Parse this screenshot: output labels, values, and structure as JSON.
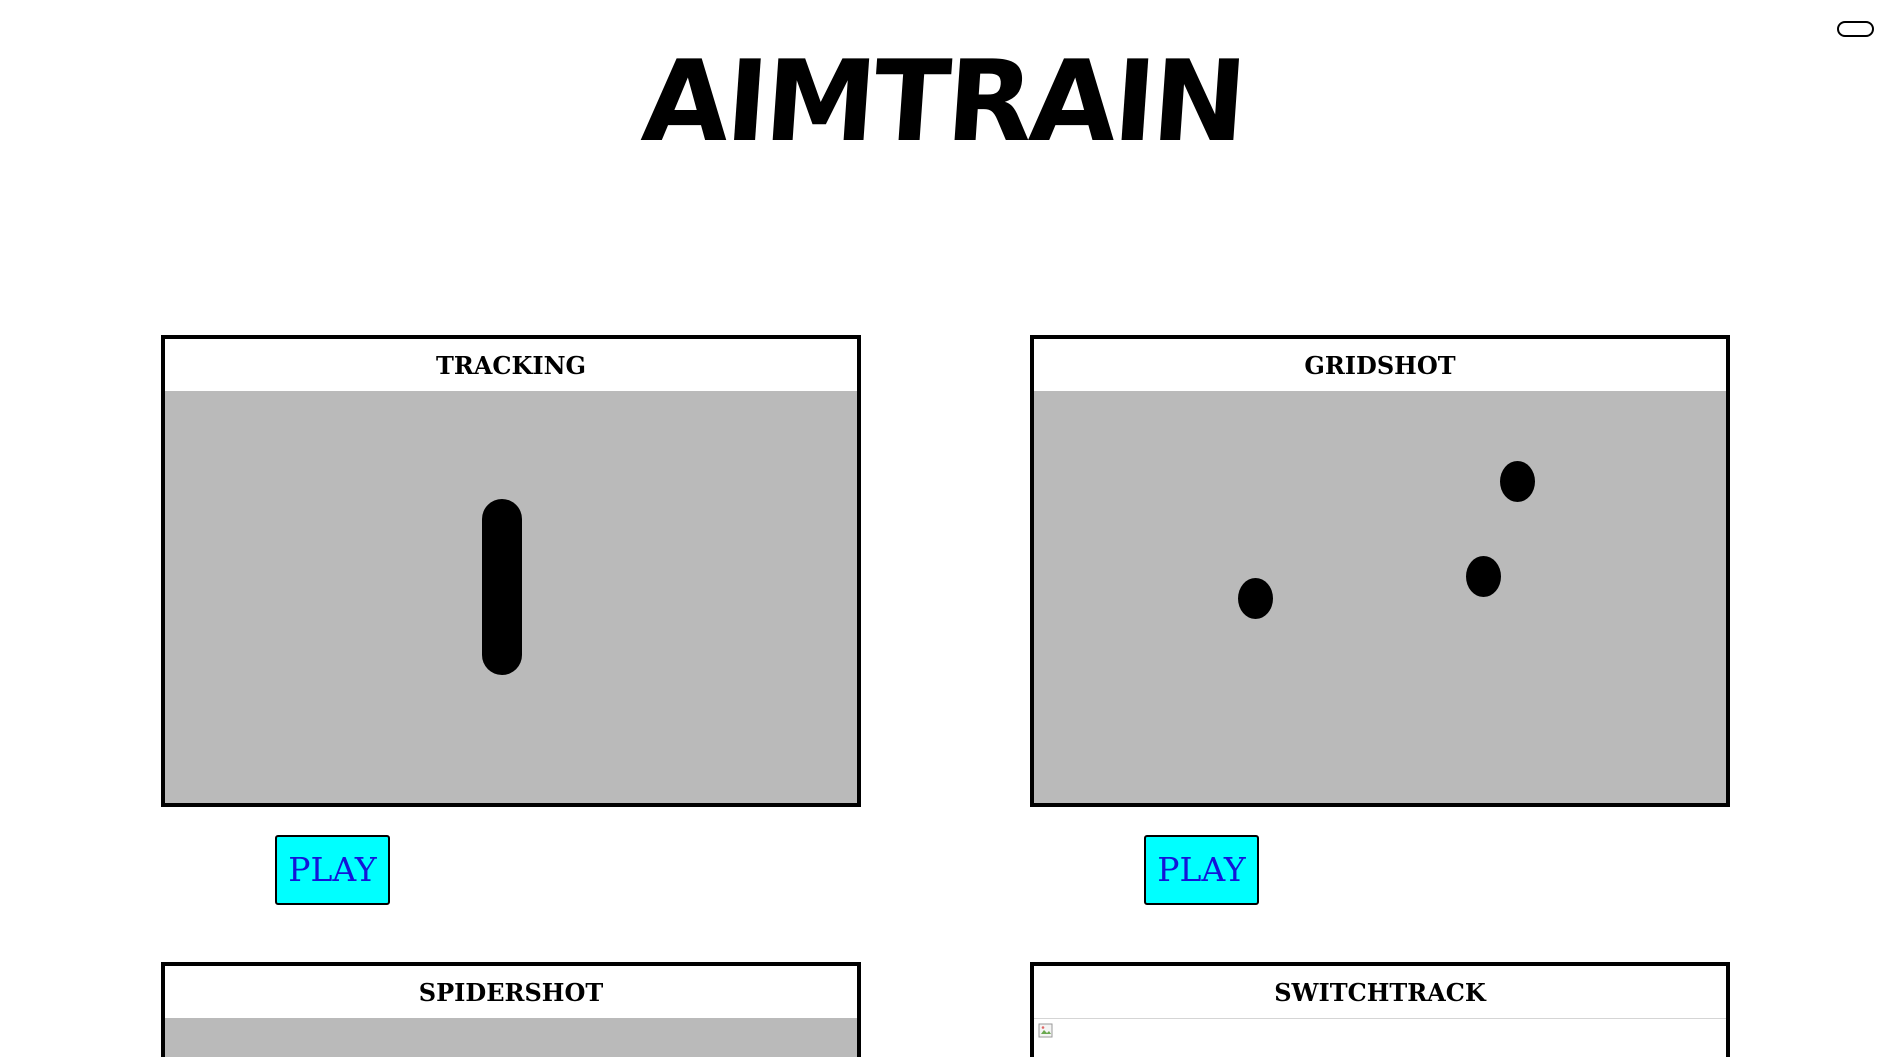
{
  "app": {
    "title": "AIMTRAIN"
  },
  "header": {
    "toggle": "theme-toggle"
  },
  "modes": [
    {
      "title": "TRACKING",
      "play_label": "PLAY",
      "preview": "tracking-target"
    },
    {
      "title": "GRIDSHOT",
      "play_label": "PLAY",
      "preview": "gridshot-targets"
    },
    {
      "title": "SPIDERSHOT",
      "play_label": "",
      "preview": "gray-preview"
    },
    {
      "title": "SWITCHTRACK",
      "play_label": "",
      "preview": "broken-image-icon"
    }
  ],
  "colors": {
    "play_background": "#00ffff",
    "play_text": "#1414d8",
    "preview_background": "#bababa",
    "border": "#000000"
  }
}
